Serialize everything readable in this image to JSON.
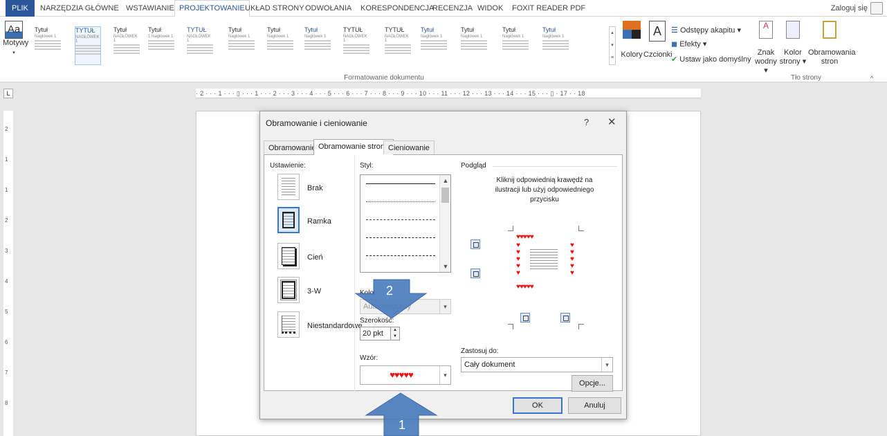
{
  "tabs": [
    "PLIK",
    "NARZĘDZIA GŁÓWNE",
    "WSTAWIANIE",
    "PROJEKTOWANIE",
    "UKŁAD STRONY",
    "ODWOŁANIA",
    "KORESPONDENCJA",
    "RECENZJA",
    "WIDOK",
    "FOXIT READER PDF"
  ],
  "login": "Zaloguj się",
  "ribbon": {
    "themes_label": "Motywy",
    "gallery": [
      {
        "t": "Tytuł",
        "h": "Nagłówek 1"
      },
      {
        "t": "TYTUŁ",
        "h": "NAGŁÓWEK 1"
      },
      {
        "t": "Tytuł",
        "h": "NAGŁÓWEK 1"
      },
      {
        "t": "Tytuł",
        "h": "1 Nagłówek 1"
      },
      {
        "t": "TYTUŁ",
        "h": "NAGŁÓWEK 1"
      },
      {
        "t": "Tytuł",
        "h": "Nagłówek 1"
      },
      {
        "t": "Tytuł",
        "h": "Nagłówek 1"
      },
      {
        "t": "Tytuł",
        "h": "Nagłówek 1"
      },
      {
        "t": "TYTUŁ",
        "h": "NAGŁÓWEK 1"
      },
      {
        "t": "TYTUŁ",
        "h": "NAGŁÓWEK 1"
      },
      {
        "t": "Tytuł",
        "h": "Nagłówek 1"
      },
      {
        "t": "Tytuł",
        "h": "Nagłówek 1"
      },
      {
        "t": "Tytuł",
        "h": "Nagłówek 1"
      },
      {
        "t": "Tytuł",
        "h": "Nagłówek 1"
      }
    ],
    "format_group": "Formatowanie dokumentu",
    "colors": "Kolory",
    "fonts": "Czcionki",
    "paragraph_spacing": "Odstępy akapitu",
    "effects": "Efekty",
    "set_default": "Ustaw jako domyślny",
    "watermark": [
      "Znak",
      "wodny"
    ],
    "page_color": [
      "Kolor",
      "strony"
    ],
    "page_borders": [
      "Obramowania",
      "stron"
    ],
    "page_bg_group": "Tło strony"
  },
  "ruler": {
    "corner": "L",
    "h": "· 2 · · · 1 · · · ▯ · · · 1 · · · 2 · · · 3 · · · 4 · · · 5 · · · 6 · · · 7 · · · 8 · · · 9 · · · 10 · · · 11 · · · 12 · · · 13 · · · 14 · · · 15 · · · ▯ · 17 · · 18",
    "v": [
      "2",
      "1",
      "1",
      "2",
      "3",
      "4",
      "5",
      "6",
      "7",
      "8"
    ]
  },
  "dialog": {
    "title": "Obramowanie i cieniowanie",
    "help": "?",
    "close": "✕",
    "tabs": [
      "Obramowanie",
      "Obramowanie strony",
      "Cieniowanie"
    ],
    "setting_label": "Ustawienie:",
    "settings": [
      "Brak",
      "Ramka",
      "Cień",
      "3-W",
      "Niestandardowe"
    ],
    "style_label": "Styl:",
    "color_label": "Kolor:",
    "color_value": "Automatyczny",
    "width_label": "Szerokość:",
    "width_value": "20 pkt",
    "art_label": "Wzór:",
    "art_value": "♥♥♥♥♥",
    "preview_label": "Podgląd",
    "preview_hint": "Kliknij odpowiednią krawędź na ilustracji lub użyj odpowiedniego przycisku",
    "apply_label": "Zastosuj do:",
    "apply_value": "Cały dokument",
    "options_button": "Opcje...",
    "ok": "OK",
    "cancel": "Anuluj"
  },
  "annotations": {
    "arrow1": "1",
    "arrow2": "2"
  },
  "colors": {
    "accent": "#2b579a",
    "arrow": "#4a7dbf",
    "heart": "#e11111"
  }
}
